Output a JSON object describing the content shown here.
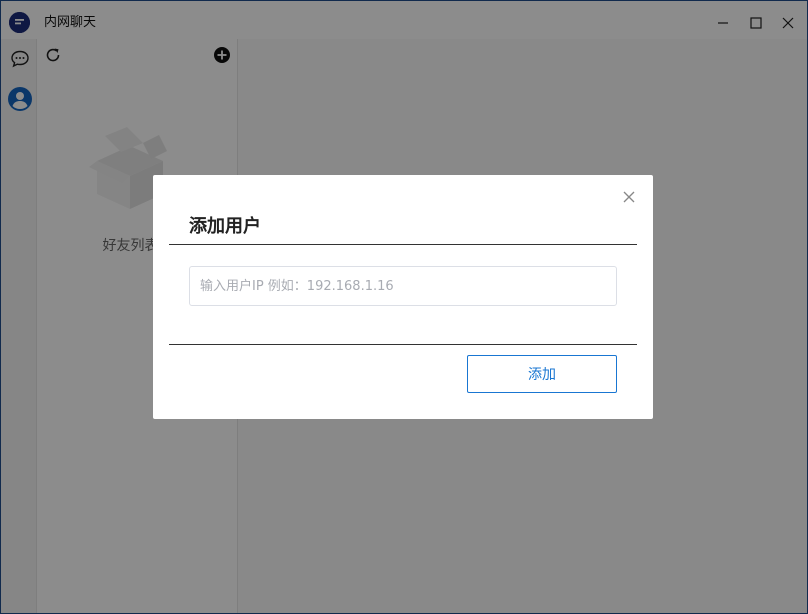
{
  "window": {
    "title": "内网聊天"
  },
  "rail": {
    "items": [
      {
        "icon": "chat-bubble-icon"
      },
      {
        "icon": "user-icon"
      }
    ]
  },
  "friends_panel": {
    "empty_text": "好友列表空"
  },
  "dialog": {
    "title": "添加用户",
    "ip_placeholder": "输入用户IP 例如：192.168.1.16",
    "ip_value": "",
    "add_label": "添加"
  },
  "colors": {
    "accent": "#1976d2",
    "app_logo": "#1d2c7a",
    "user_icon": "#1565c0"
  }
}
